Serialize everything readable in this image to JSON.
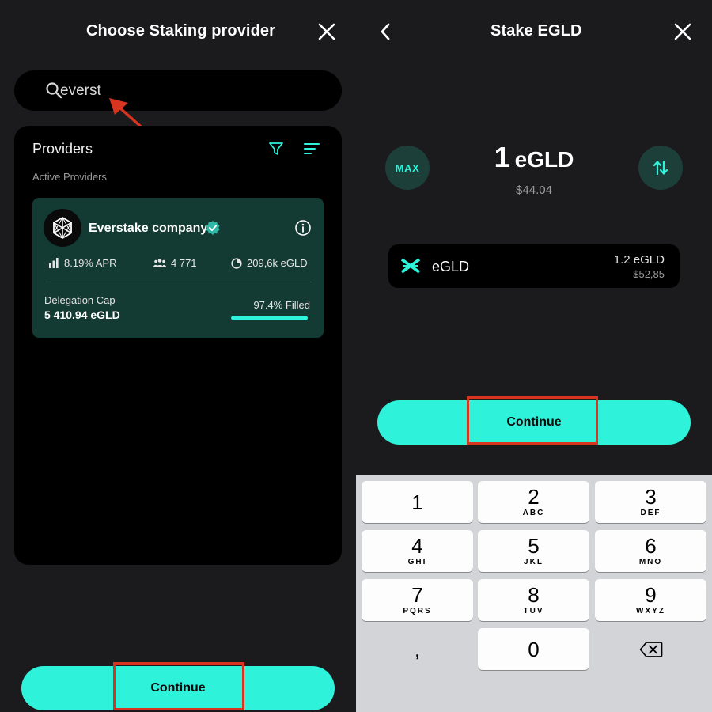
{
  "left": {
    "title": "Choose Staking provider",
    "search": {
      "value": "everst",
      "placeholder": ""
    },
    "providers_title": "Providers",
    "active_label": "Active Providers",
    "provider": {
      "name": "Everstake company",
      "apr": "8.19% APR",
      "delegators": "4 771",
      "total_staked": "209,6k eGLD",
      "cap_label": "Delegation Cap",
      "cap_value": "5 410.94 eGLD",
      "filled_label": "97.4% Filled",
      "filled_fraction": 0.974
    },
    "continue_label": "Continue"
  },
  "right": {
    "title": "Stake EGLD",
    "max_label": "MAX",
    "amount_value": "1",
    "amount_unit": "eGLD",
    "amount_fiat": "$44.04",
    "token": {
      "name": "eGLD",
      "balance": "1.2 eGLD",
      "balance_fiat": "$52,85"
    },
    "continue_label": "Continue"
  },
  "keypad": [
    {
      "num": "1",
      "letters": ""
    },
    {
      "num": "2",
      "letters": "ABC"
    },
    {
      "num": "3",
      "letters": "DEF"
    },
    {
      "num": "4",
      "letters": "GHI"
    },
    {
      "num": "5",
      "letters": "JKL"
    },
    {
      "num": "6",
      "letters": "MNO"
    },
    {
      "num": "7",
      "letters": "PQRS"
    },
    {
      "num": "8",
      "letters": "TUV"
    },
    {
      "num": "9",
      "letters": "WXYZ"
    },
    {
      "num": ",",
      "letters": ""
    },
    {
      "num": "0",
      "letters": ""
    }
  ],
  "colors": {
    "accent": "#2ef2d9",
    "card_bg": "#143a34",
    "highlight": "#d9341f",
    "annotation_arrow": "#d9341f"
  },
  "icons": [
    "search-icon",
    "close-icon",
    "back-icon",
    "filter-icon",
    "sort-icon",
    "verified-icon",
    "info-icon",
    "bar-chart-icon",
    "users-icon",
    "pie-chart-icon",
    "swap-icon",
    "egld-logo-icon",
    "backspace-icon"
  ]
}
